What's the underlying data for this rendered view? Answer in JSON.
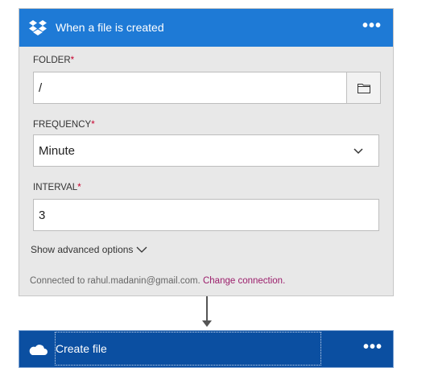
{
  "trigger": {
    "title": "When a file is created",
    "more": "•••",
    "folder": {
      "label": "FOLDER",
      "required_mark": "*",
      "value": "/"
    },
    "frequency": {
      "label": "FREQUENCY",
      "required_mark": "*",
      "value": "Minute"
    },
    "interval": {
      "label": "INTERVAL",
      "required_mark": "*",
      "value": "3"
    },
    "advanced_label": "Show advanced options",
    "connection_text": "Connected to rahul.madanin@gmail.com.",
    "connection_link": "Change connection."
  },
  "action": {
    "title": "Create file",
    "more": "•••"
  },
  "colors": {
    "dropbox_header": "#1e7ad6",
    "onedrive_header": "#0b4fa1",
    "link": "#9b1d6b",
    "required": "#c8002d"
  },
  "icons": {
    "trigger": "dropbox-icon",
    "folder_picker": "folder-icon",
    "dropdown": "chevron-down-icon",
    "action": "onedrive-cloud-icon"
  }
}
